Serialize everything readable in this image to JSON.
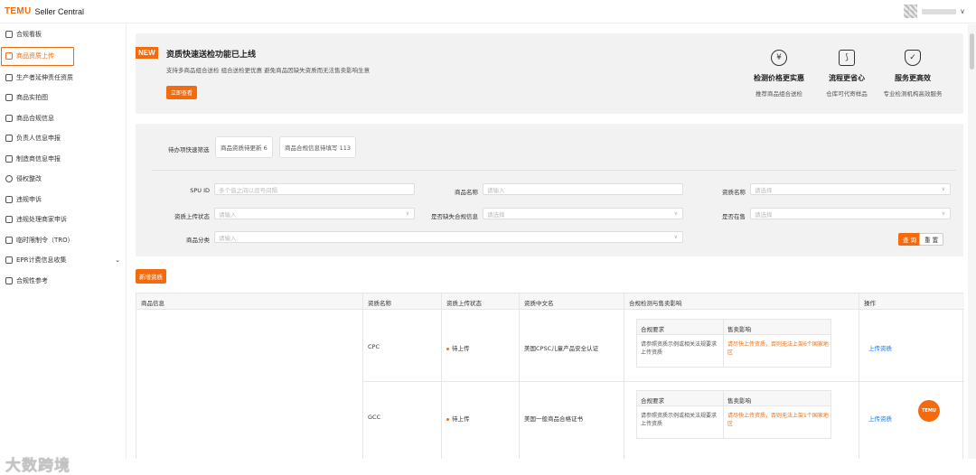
{
  "header": {
    "logo": "TEMU",
    "app_name": "Seller Central",
    "caret": "∨"
  },
  "sidebar": {
    "items": [
      {
        "label": "合规看板",
        "icon": "dashboard-icon"
      },
      {
        "label": "商品资质上传",
        "icon": "upload-icon",
        "active": true
      },
      {
        "label": "生产者延伸责任资质",
        "icon": "recycle-icon"
      },
      {
        "label": "商品实拍图",
        "icon": "photo-icon"
      },
      {
        "label": "商品合规信息",
        "icon": "document-icon"
      },
      {
        "label": "负责人信息申报",
        "icon": "person-icon"
      },
      {
        "label": "制造商信息申报",
        "icon": "factory-icon"
      },
      {
        "label": "侵权整改",
        "icon": "warning-icon"
      },
      {
        "label": "违规申诉",
        "icon": "appeal-icon"
      },
      {
        "label": "违规处理商家申诉",
        "icon": "appeal-merchant-icon"
      },
      {
        "label": "临时限制令（TRO）",
        "icon": "restriction-icon"
      },
      {
        "label": "EPR计费信息收集",
        "icon": "billing-icon",
        "expandable": true
      },
      {
        "label": "合规性参考",
        "icon": "reference-icon"
      }
    ],
    "watermark": "大数跨境"
  },
  "banner": {
    "badge": "NEW",
    "title": "资质快速送检功能已上线",
    "subtitle": "支持多商品组合送检 组合送检更优惠 避免商品因缺失资质而无法售卖影响生意",
    "button": "立即查看",
    "features": [
      {
        "icon": "yen-icon",
        "glyph": "¥",
        "title": "检测价格更实惠",
        "desc": "推荐商品组合送检"
      },
      {
        "icon": "flow-icon",
        "glyph": "⟆",
        "title": "流程更省心",
        "desc": "仓库可代寄样品"
      },
      {
        "icon": "shield-check-icon",
        "glyph": "✓",
        "title": "服务更高效",
        "desc": "专业检测机构高效服务"
      }
    ]
  },
  "filter": {
    "quick_label": "待办项快速筛选",
    "chips": [
      "商品资质待更新 6",
      "商品合规信息待填写 113"
    ],
    "fields": {
      "spu_id": {
        "label": "SPU ID",
        "placeholder": "多个值之间以逗号间隔"
      },
      "product_name": {
        "label": "商品名称",
        "placeholder": "请输入"
      },
      "qual_name": {
        "label": "资质名称",
        "placeholder": "请选择"
      },
      "upload_status": {
        "label": "资质上传状态",
        "placeholder": "请输入"
      },
      "missing_info": {
        "label": "是否缺失合规信息",
        "placeholder": "请选择"
      },
      "on_sale": {
        "label": "是否在售",
        "placeholder": "请选择"
      },
      "category": {
        "label": "商品分类",
        "placeholder": "请输入"
      }
    },
    "search_button": "查 询",
    "reset_button": "重 置"
  },
  "add_button": "新增资质",
  "table": {
    "headers": [
      "商品信息",
      "资质名称",
      "资质上传状态",
      "资质中文名",
      "合规检测与售卖影响",
      "操作"
    ],
    "sub_headers": [
      "合规要求",
      "售卖影响"
    ],
    "rows": [
      {
        "qual": "CPC",
        "status": "待上传",
        "cn_name": "美国CPSC儿童产品安全认证",
        "requirement": "请参照资质示例或相关法规要求上传资质",
        "impact": "请尽快上传资质，否则无法上架6个国家地区",
        "action": "上传资质"
      },
      {
        "qual": "GCC",
        "status": "待上传",
        "cn_name": "美国一般商品合格证书",
        "requirement": "请参照资质示例或相关法规要求上传资质",
        "impact": "请尽快上传资质，否则无法上架1个国家地区",
        "action": "上传资质"
      }
    ]
  },
  "fab": "TEMU",
  "colors": {
    "accent": "#f26b0f",
    "link": "#1677ff",
    "panel": "#f2f2f2"
  }
}
